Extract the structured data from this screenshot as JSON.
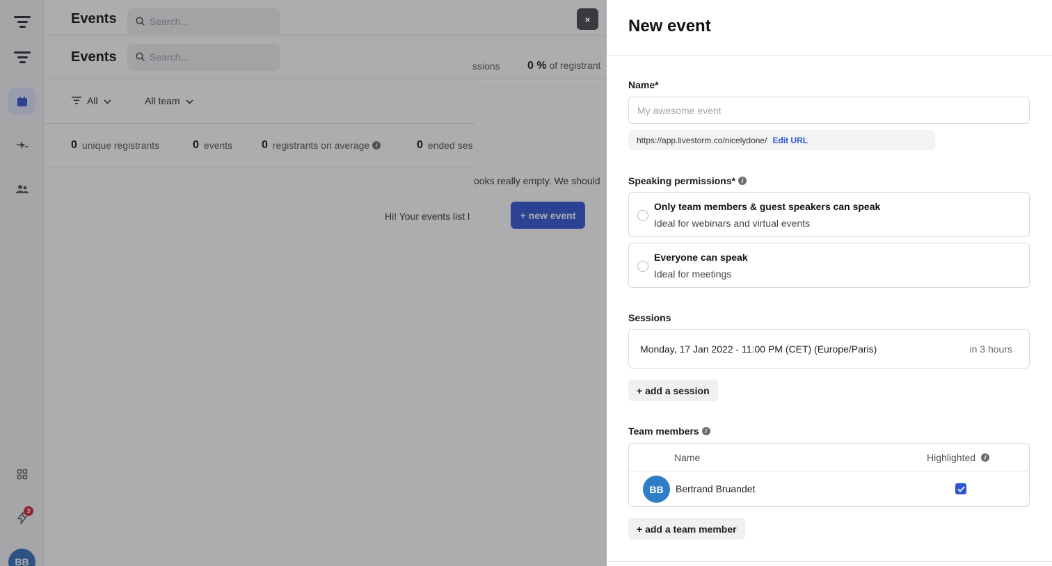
{
  "app": {
    "title": "Events",
    "search_placeholder": "Search...",
    "nav_badge_count": "3",
    "user_initials": "BB",
    "filters": {
      "status": "All",
      "team": "All team"
    },
    "stats": [
      {
        "value": "0",
        "label": "unique registrants"
      },
      {
        "value": "0",
        "label": "events"
      },
      {
        "value": "0",
        "label": "registrants on average"
      },
      {
        "value": "0",
        "label": "ended ses"
      }
    ],
    "partial": {
      "sessions_label": "ssions",
      "pct_value": "0 %",
      "pct_label": "of registrant",
      "empty_left": "Hi! Your events list l",
      "empty_right": "ooks really empty. We should"
    },
    "new_event_button": "+ new event",
    "close_label": "×"
  },
  "drawer": {
    "title": "New event",
    "name": {
      "label": "Name*",
      "placeholder": "My awesome event",
      "url": "https://app.livestorm.co/nicelydone/",
      "edit_url": "Edit URL"
    },
    "speaking": {
      "label": "Speaking permissions*",
      "options": [
        {
          "title": "Only team members & guest speakers can speak",
          "subtitle": "Ideal for webinars and virtual events"
        },
        {
          "title": "Everyone can speak",
          "subtitle": "Ideal for meetings"
        }
      ]
    },
    "sessions": {
      "label": "Sessions",
      "date": "Monday, 17 Jan 2022 - 11:00 PM (CET) (Europe/Paris)",
      "relative": "in 3 hours",
      "add_label": "+ add a session"
    },
    "team": {
      "label": "Team members",
      "col_name": "Name",
      "col_highlighted": "Highlighted",
      "members": [
        {
          "initials": "BB",
          "name": "Bertrand Bruandet",
          "highlighted": true
        }
      ],
      "add_label": "+ add a team member"
    }
  },
  "colors": {
    "accent": "#2f55d4",
    "avatar_blue": "#2f7cc7",
    "badge_red": "#d6213b"
  }
}
